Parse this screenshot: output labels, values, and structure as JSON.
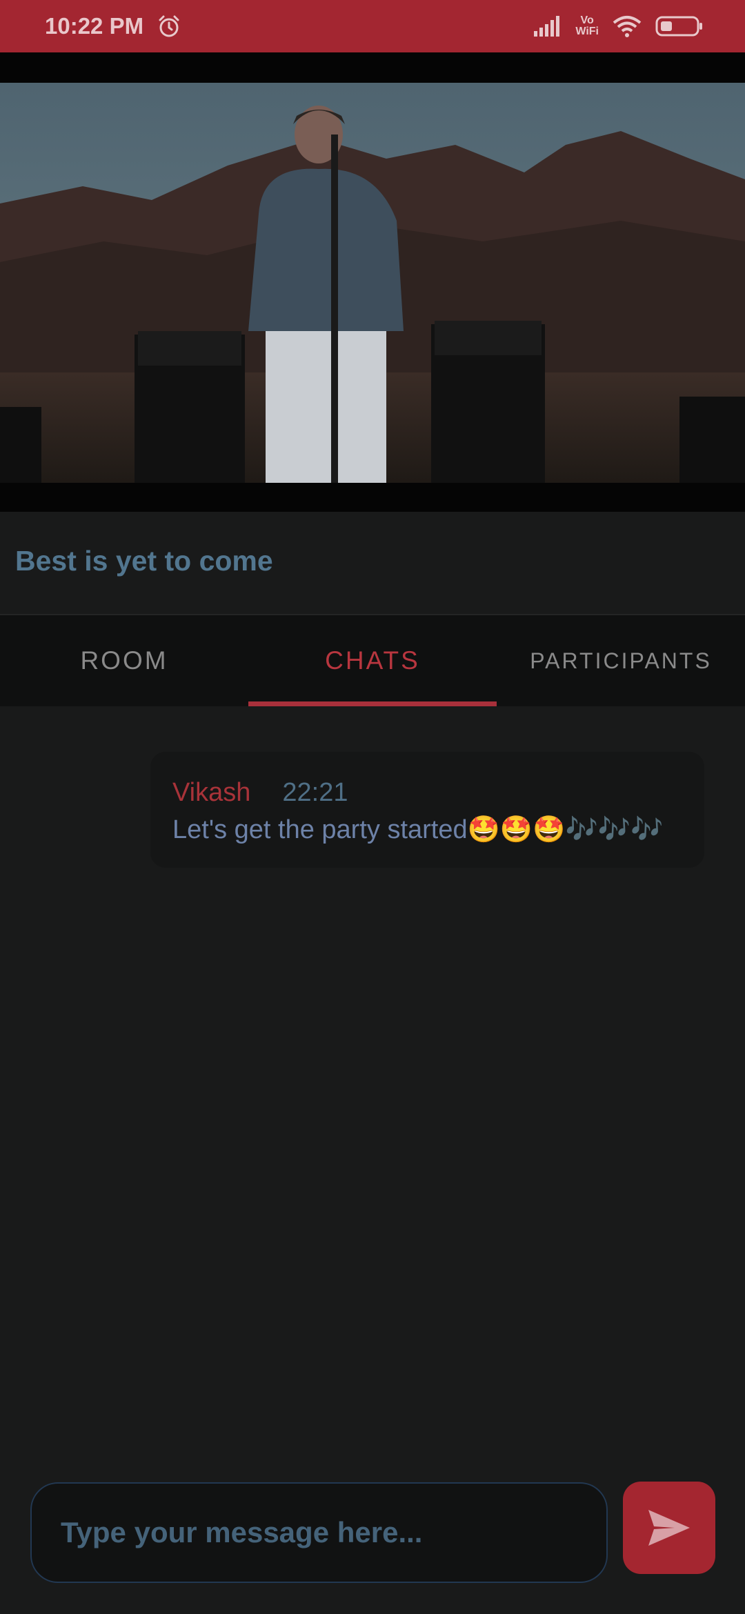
{
  "status_bar": {
    "time": "10:22 PM",
    "vowifi_top": "Vo",
    "vowifi_bottom": "WiFi",
    "icons": [
      "alarm-icon",
      "signal-icon",
      "wifi-icon",
      "battery-icon"
    ],
    "color": "#a32631"
  },
  "video": {
    "title": "Best is yet to come"
  },
  "tabs": [
    {
      "label": "ROOM",
      "active": false
    },
    {
      "label": "CHATS",
      "active": true
    },
    {
      "label": "PARTICIPANTS",
      "active": false
    }
  ],
  "chat": {
    "messages": [
      {
        "sender": "Vikash",
        "time": "22:21",
        "text": "Let's get the party started🤩🤩🤩🎶🎶🎶"
      }
    ]
  },
  "composer": {
    "placeholder": "Type your message here...",
    "send_icon": "send-icon"
  },
  "colors": {
    "accent": "#a42630",
    "background": "#191a1a"
  }
}
